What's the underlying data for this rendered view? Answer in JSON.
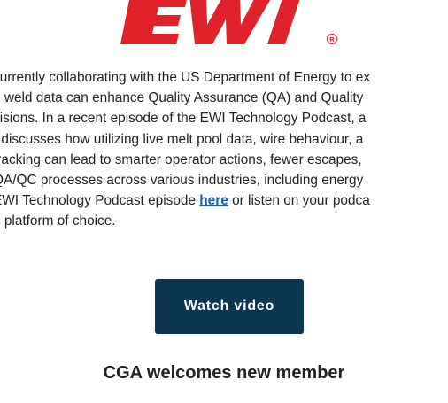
{
  "logo": {
    "text": "EWI",
    "registered_mark": "®",
    "brand_color": "#e2222b"
  },
  "article": {
    "lines": [
      "currently collaborating with the US Department of Energy to ex",
      "g weld data can enhance Quality Assurance (QA) and Quality",
      "cisions. In a recent episode of the EWI Technology Podcast, a",
      "r discusses how utilizing live melt pool data, wire behaviour, a",
      "tracking can lead to smarter operator actions, fewer escapes,",
      "QA/QC processes across various industries, including energy"
    ],
    "last_line_prefix": "EWI Technology Podcast episode ",
    "link_text": "here",
    "last_line_suffix": " or listen on your podca",
    "final_line": "g platform of choice.",
    "link_color": "#1a5fb4"
  },
  "cta": {
    "label": "Watch video",
    "background_color": "#0b3551"
  },
  "next_section": {
    "title": "CGA welcomes new member"
  }
}
